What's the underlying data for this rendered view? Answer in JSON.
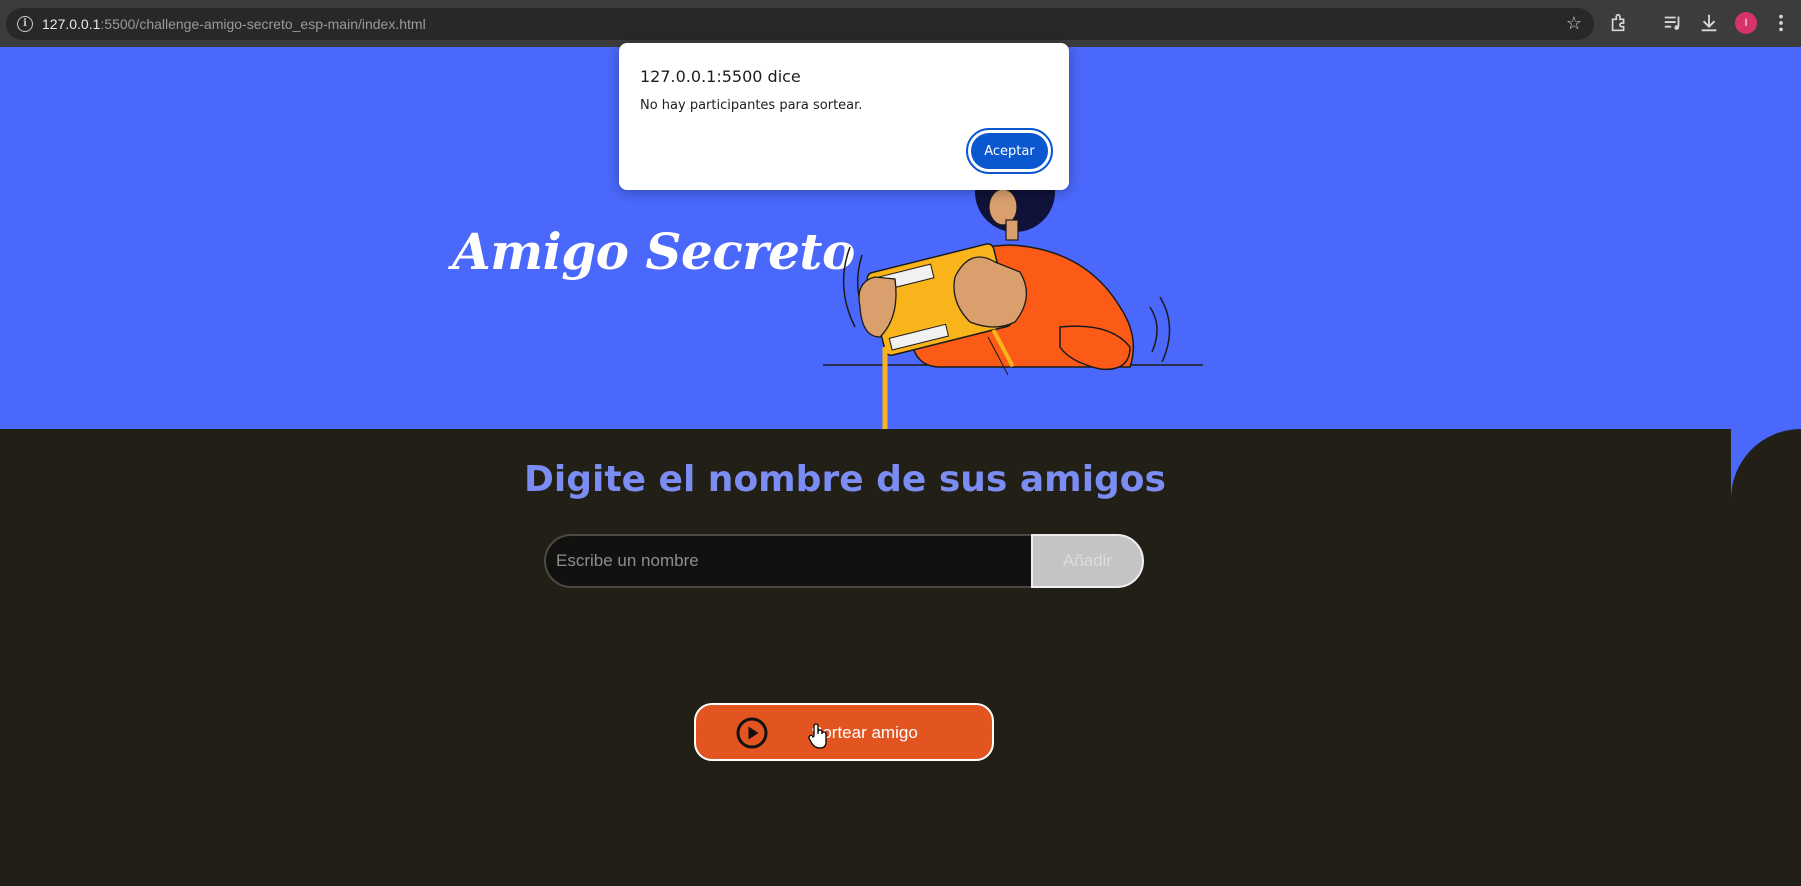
{
  "browser": {
    "url_host": "127.0.0.1",
    "url_rest": ":5500/challenge-amigo-secreto_esp-main/index.html",
    "avatar_initial": "I"
  },
  "hero": {
    "title": "Amigo Secreto"
  },
  "main": {
    "section_title": "Digite el nombre de sus amigos",
    "input_placeholder": "Escribe un nombre",
    "add_label": "Añadir",
    "draw_label": "Sortear amigo"
  },
  "dialog": {
    "title": "127.0.0.1:5500 dice",
    "message": "No hay participantes para sortear.",
    "accept_label": "Aceptar"
  },
  "colors": {
    "hero_bg": "#4a68fb",
    "main_bg": "#211f16",
    "section_title": "#7b8cf2",
    "draw_button": "#e35520",
    "dialog_button": "#0b57d0"
  },
  "icons": [
    "site-info-icon",
    "star-icon",
    "extensions-icon",
    "media-icon",
    "download-icon",
    "menu-icon",
    "play-icon",
    "hand-cursor-icon"
  ]
}
